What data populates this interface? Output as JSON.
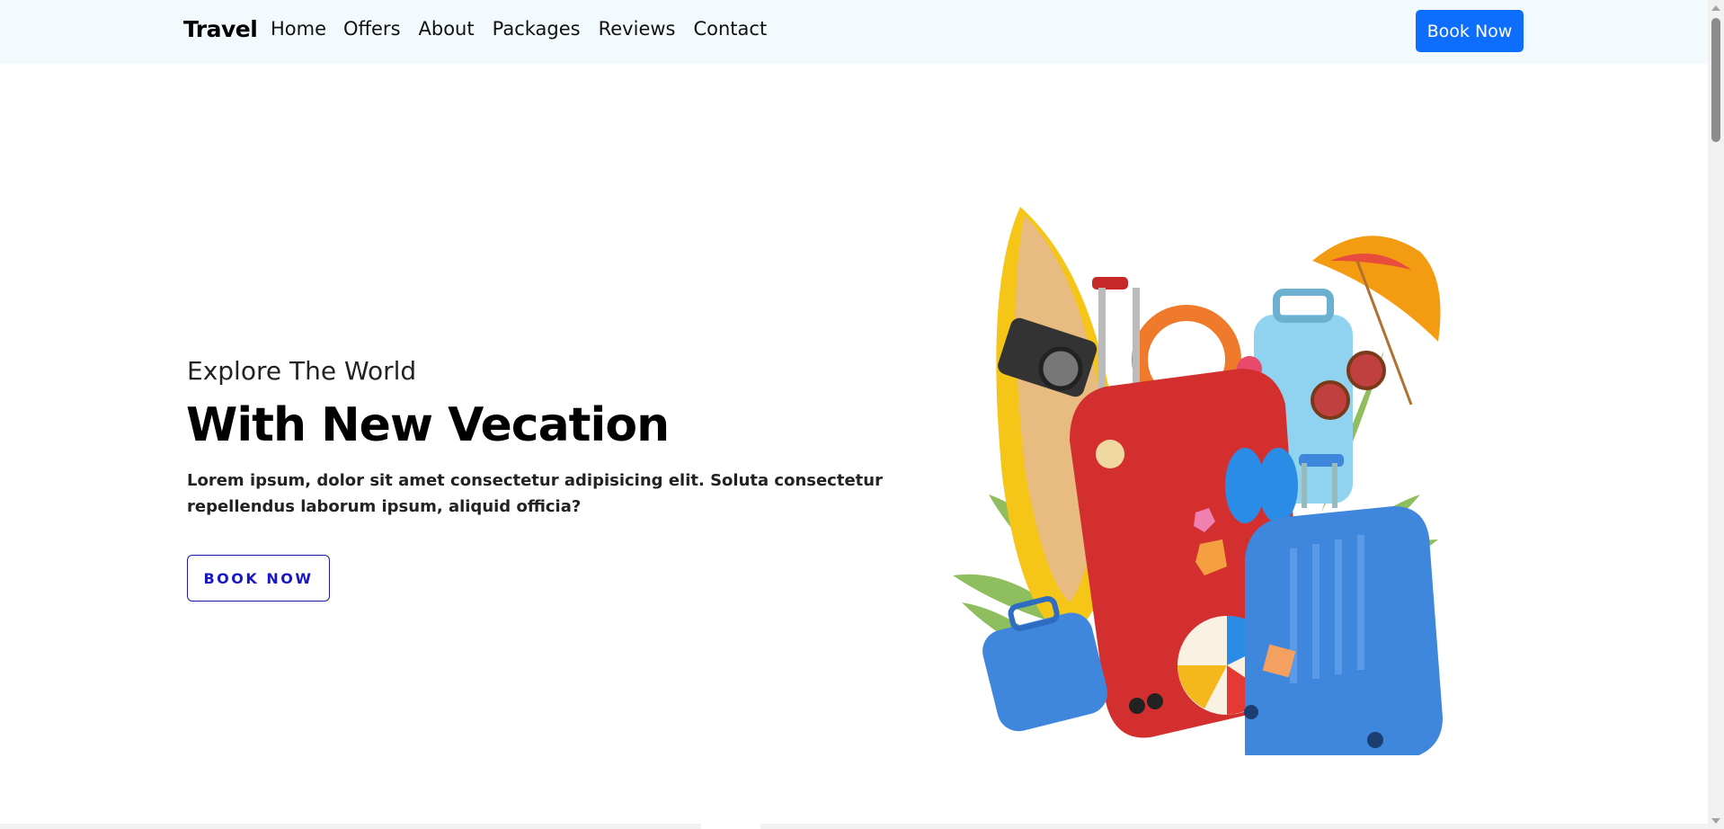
{
  "navbar": {
    "brand": "Travel",
    "links": [
      "Home",
      "Offers",
      "About",
      "Packages",
      "Reviews",
      "Contact"
    ],
    "cta": "Book Now"
  },
  "hero": {
    "subtitle": "Explore The World",
    "title": "With New Vecation",
    "text": "Lorem ipsum, dolor sit amet consectetur adipisicing elit. Soluta consectetur repellendus laborum ipsum, aliquid officia?",
    "cta": "BOOK NOW",
    "image": "travel-luggage-illustration"
  },
  "colors": {
    "navbar_bg": "#f3fafe",
    "primary": "#0d6efd",
    "outline_button": "#1717c4"
  }
}
